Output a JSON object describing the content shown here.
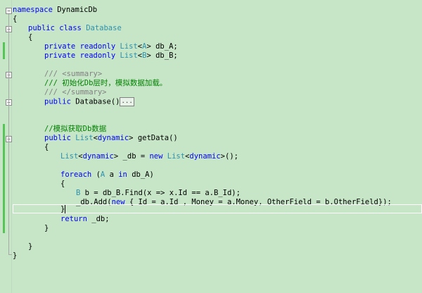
{
  "editor": {
    "namespace_kw": "namespace",
    "namespace_name": "DynamicDb",
    "public": "public",
    "private": "private",
    "readonly": "readonly",
    "class": "class",
    "new": "new",
    "foreach": "foreach",
    "in": "in",
    "return": "return",
    "class_name": "Database",
    "list": "List",
    "type_a": "A",
    "type_b": "B",
    "dynamic": "dynamic",
    "field_a": "db_A;",
    "field_b": "db_B;",
    "summary_open": "/// <summary>",
    "summary_text": "/// 初始化Db层时，模拟数据加载。",
    "summary_close": "/// </summary>",
    "ctor_sig": "Database()",
    "collapsed_marker": "...",
    "comment_getdata": "//模拟获取Db数据",
    "getdata_sig": "getData()",
    "db_decl_var": "_db =",
    "db_decl_tail": "();",
    "foreach_var": "a",
    "foreach_source": "db_A)",
    "find_var": "b = db_B.Find(x => x.Id == a.B_Id);",
    "add_call": "_db.Add(",
    "add_args": "{ Id = a.Id , Money = a.Money, OtherField = b.OtherField});",
    "return_text": "_db;",
    "brace_open": "{",
    "brace_close": "}",
    "paren_open": "(",
    "lt": "<",
    "gt": ">"
  }
}
